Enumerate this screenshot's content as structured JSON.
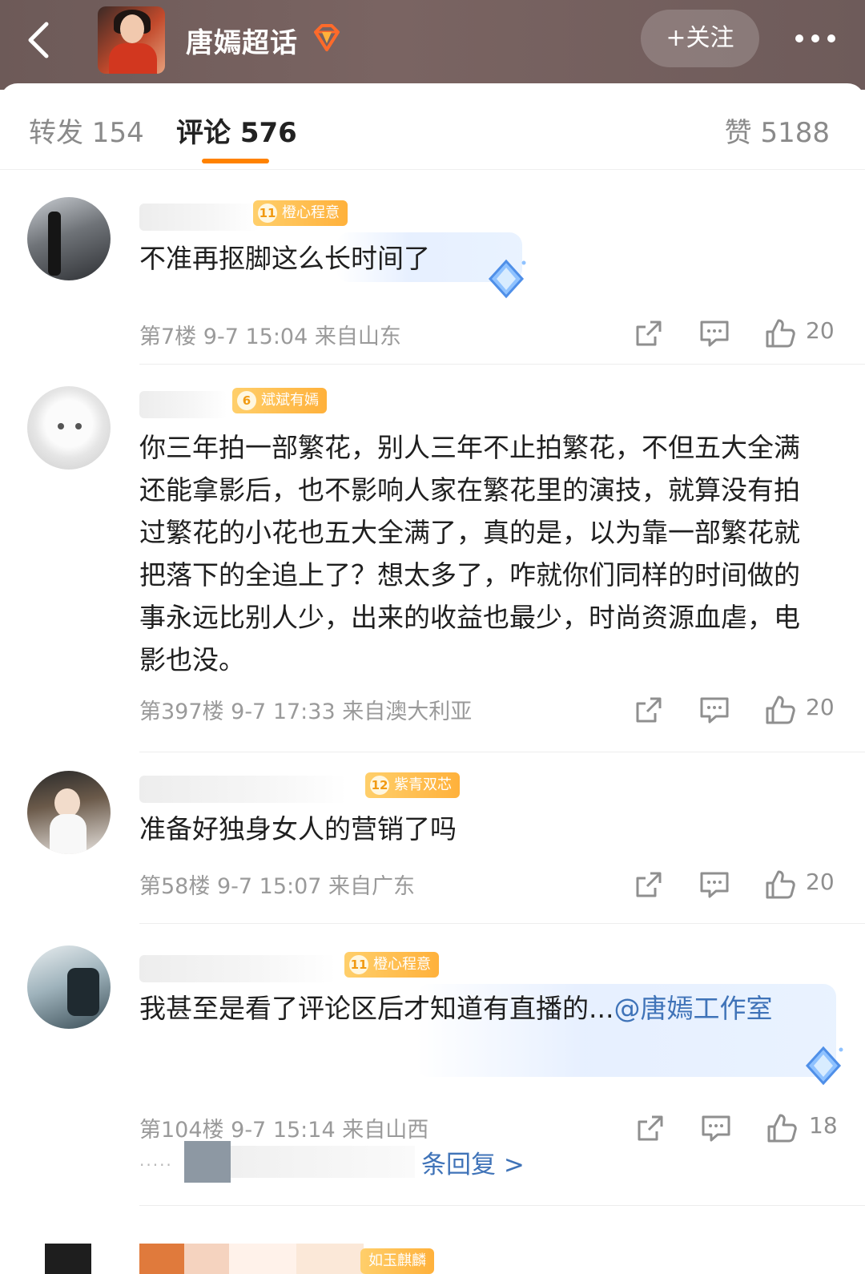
{
  "header": {
    "topic_title": "唐嫣超话",
    "follow_label": "+关注",
    "icons": [
      "back-icon",
      "gem-icon",
      "more-icon"
    ]
  },
  "tabs": {
    "repost": "转发 154",
    "comments": "评论 576",
    "likes": "赞 5188"
  },
  "comments": [
    {
      "badge_level": "11",
      "badge_label": "橙心程意",
      "text": "不准再抠脚这么长时间了",
      "floor": "第7楼",
      "time": "9-7 15:04",
      "location": "来自山东",
      "likes": "20"
    },
    {
      "badge_level": "6",
      "badge_label": "斌斌有嫣",
      "text": "你三年拍一部繁花，别人三年不止拍繁花，不但五大全满还能拿影后，也不影响人家在繁花里的演技，就算没有拍过繁花的小花也五大全满了，真的是，以为靠一部繁花就把落下的全追上了？想太多了，咋就你们同样的时间做的事永远比别人少，出来的收益也最少，时尚资源血虐，电影也没。",
      "floor": "第397楼",
      "time": "9-7 17:33",
      "location": "来自澳大利亚",
      "likes": "20"
    },
    {
      "badge_level": "12",
      "badge_label": "紫青双芯",
      "text": "准备好独身女人的营销了吗",
      "floor": "第58楼",
      "time": "9-7 15:07",
      "location": "来自广东",
      "likes": "20"
    },
    {
      "badge_level": "11",
      "badge_label": "橙心程意",
      "text": "我甚至是看了评论区后才知道有直播的...",
      "mention": "@唐嫣工作室",
      "floor": "第104楼",
      "time": "9-7 15:14",
      "location": "来自山西",
      "likes": "18"
    }
  ],
  "replies_link": "条回复 >",
  "next_comment": {
    "badge_label": "如玉麒麟"
  },
  "colors": {
    "accent_orange": "#ff8200",
    "link_blue": "#3f73b8",
    "badge_gold": "#ffb13b"
  }
}
